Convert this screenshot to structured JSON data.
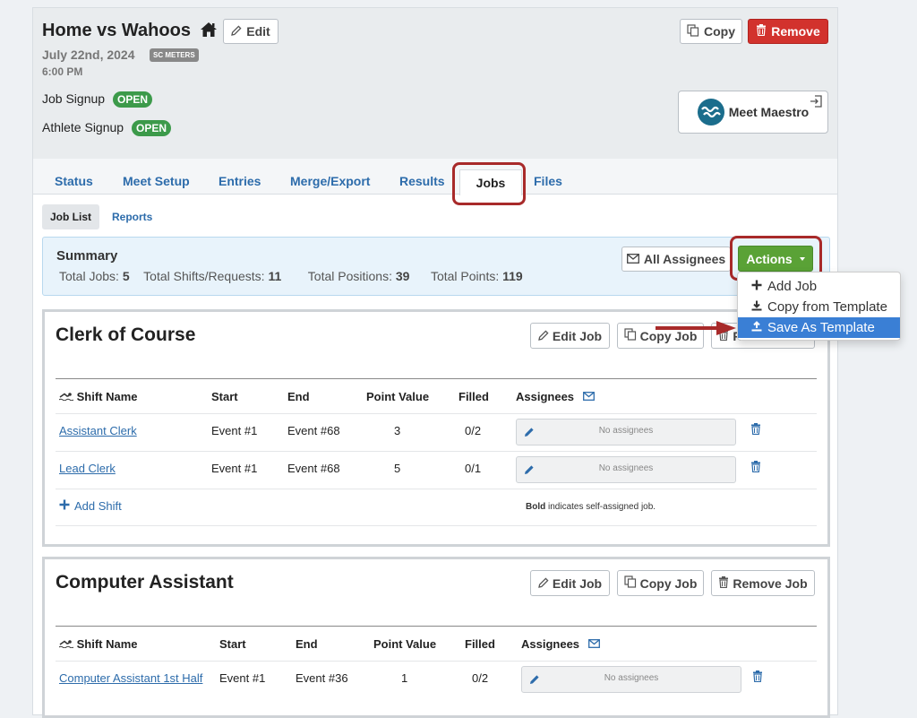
{
  "meet": {
    "title": "Home vs Wahoos",
    "edit_label": "Edit",
    "copy_label": "Copy",
    "remove_label": "Remove",
    "date": "July 22nd, 2024",
    "course_badge": "SC METERS",
    "time": "6:00 PM",
    "job_signup_label": "Job Signup",
    "job_signup_status": "OPEN",
    "athlete_signup_label": "Athlete Signup",
    "athlete_signup_status": "OPEN",
    "meet_maestro_label": "Meet Maestro"
  },
  "tabs": [
    {
      "label": "Status"
    },
    {
      "label": "Meet Setup"
    },
    {
      "label": "Entries"
    },
    {
      "label": "Merge/Export"
    },
    {
      "label": "Results"
    },
    {
      "label": "Jobs",
      "active": true
    },
    {
      "label": "Files"
    }
  ],
  "subtabs": [
    {
      "label": "Job List",
      "active": true
    },
    {
      "label": "Reports"
    }
  ],
  "summary": {
    "title": "Summary",
    "total_jobs_label": "Total Jobs:",
    "total_jobs": "5",
    "total_shifts_label": "Total Shifts/Requests:",
    "total_shifts": "11",
    "total_positions_label": "Total Positions:",
    "total_positions": "39",
    "total_points_label": "Total Points:",
    "total_points": "119",
    "all_assignees_label": "All Assignees",
    "actions_label": "Actions"
  },
  "actions_menu": [
    {
      "label": "Add Job",
      "icon": "plus-icon"
    },
    {
      "label": "Copy from Template",
      "icon": "download-icon"
    },
    {
      "label": "Save As Template",
      "icon": "upload-icon",
      "selected": true
    }
  ],
  "job_buttons": {
    "edit": "Edit Job",
    "copy": "Copy Job",
    "remove": "Remove Job"
  },
  "table_headers": {
    "shift_name": "Shift Name",
    "start": "Start",
    "end": "End",
    "point_value": "Point Value",
    "filled": "Filled",
    "assignees": "Assignees"
  },
  "no_assignees": "No assignees",
  "add_shift_label": "Add Shift",
  "bold_note_bold": "Bold",
  "bold_note_rest": " indicates self-assigned job.",
  "jobs": [
    {
      "title": "Clerk of Course",
      "shifts": [
        {
          "name": "Assistant Clerk",
          "start": "Event #1",
          "end": "Event #68",
          "points": "3",
          "filled": "0/2"
        },
        {
          "name": "Lead Clerk",
          "start": "Event #1",
          "end": "Event #68",
          "points": "5",
          "filled": "0/1"
        }
      ]
    },
    {
      "title": "Computer Assistant",
      "shifts": [
        {
          "name": "Computer Assistant 1st Half",
          "start": "Event #1",
          "end": "Event #36",
          "points": "1",
          "filled": "0/2"
        }
      ]
    }
  ],
  "colors": {
    "link": "#2d6cab",
    "remove": "#d2322d",
    "actions": "#5aa236",
    "open_badge": "#3c9a4a",
    "highlight": "#a82a2a",
    "menu_selected": "#3a7fd5"
  }
}
